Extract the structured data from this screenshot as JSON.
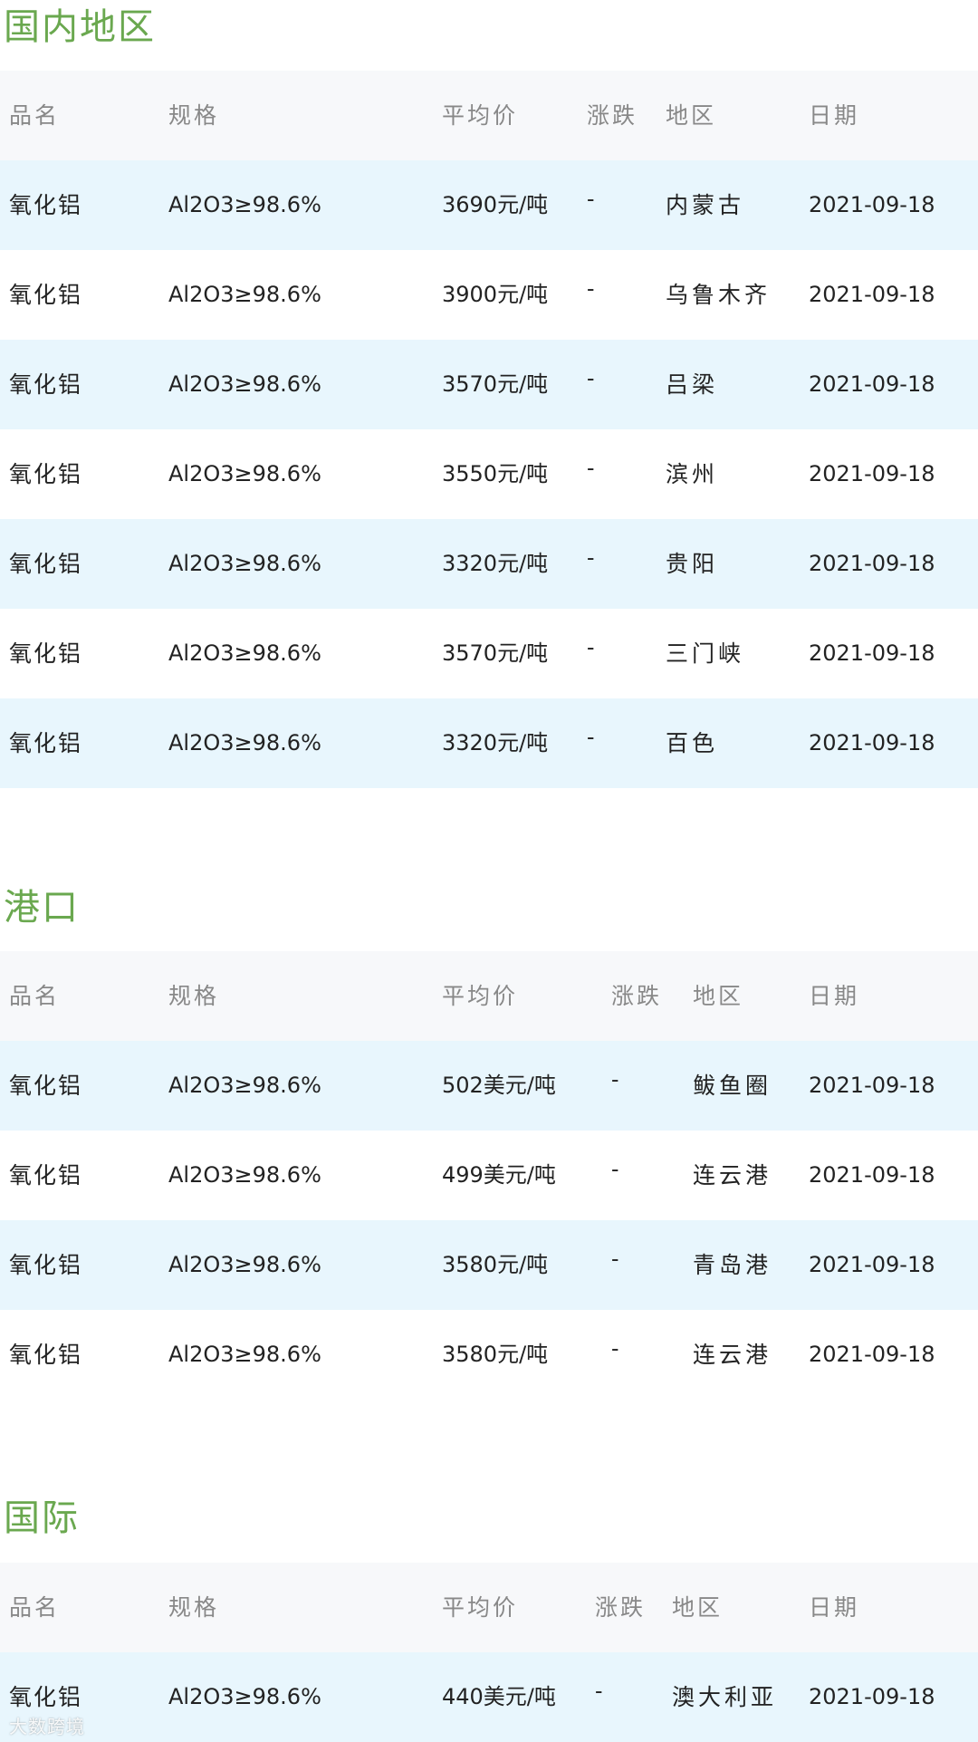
{
  "header": {
    "col_name": "品名",
    "col_spec": "规格",
    "col_price": "平均价",
    "col_change": "涨跌",
    "col_region": "地区",
    "col_date": "日期"
  },
  "domestic": {
    "title": "国内地区",
    "rows": [
      {
        "name": "氧化铝",
        "spec": "Al2O3≥98.6%",
        "price": "3690元/吨",
        "change": "-",
        "region": "内蒙古",
        "date": "2021-09-18"
      },
      {
        "name": "氧化铝",
        "spec": "Al2O3≥98.6%",
        "price": "3900元/吨",
        "change": "-",
        "region": "乌鲁木齐",
        "date": "2021-09-18"
      },
      {
        "name": "氧化铝",
        "spec": "Al2O3≥98.6%",
        "price": "3570元/吨",
        "change": "-",
        "region": "吕梁",
        "date": "2021-09-18"
      },
      {
        "name": "氧化铝",
        "spec": "Al2O3≥98.6%",
        "price": "3550元/吨",
        "change": "-",
        "region": "滨州",
        "date": "2021-09-18"
      },
      {
        "name": "氧化铝",
        "spec": "Al2O3≥98.6%",
        "price": "3320元/吨",
        "change": "-",
        "region": "贵阳",
        "date": "2021-09-18"
      },
      {
        "name": "氧化铝",
        "spec": "Al2O3≥98.6%",
        "price": "3570元/吨",
        "change": "-",
        "region": "三门峡",
        "date": "2021-09-18"
      },
      {
        "name": "氧化铝",
        "spec": "Al2O3≥98.6%",
        "price": "3320元/吨",
        "change": "-",
        "region": "百色",
        "date": "2021-09-18"
      }
    ]
  },
  "port": {
    "title": "港口",
    "rows": [
      {
        "name": "氧化铝",
        "spec": "Al2O3≥98.6%",
        "price": "502美元/吨",
        "change": "-",
        "region": "鲅鱼圈",
        "date": "2021-09-18"
      },
      {
        "name": "氧化铝",
        "spec": "Al2O3≥98.6%",
        "price": "499美元/吨",
        "change": "-",
        "region": "连云港",
        "date": "2021-09-18"
      },
      {
        "name": "氧化铝",
        "spec": "Al2O3≥98.6%",
        "price": "3580元/吨",
        "change": "-",
        "region": "青岛港",
        "date": "2021-09-18"
      },
      {
        "name": "氧化铝",
        "spec": "Al2O3≥98.6%",
        "price": "3580元/吨",
        "change": "-",
        "region": "连云港",
        "date": "2021-09-18"
      }
    ]
  },
  "international": {
    "title": "国际",
    "rows": [
      {
        "name": "氧化铝",
        "spec": "Al2O3≥98.6%",
        "price": "440美元/吨",
        "change": "-",
        "region": "澳大利亚",
        "date": "2021-09-18"
      }
    ]
  },
  "watermark": "大数跨境",
  "colors": {
    "title_green": "#6aa84f",
    "header_bg": "#f7f8fa",
    "stripe_bg": "#e8f6fd",
    "header_text": "#888888",
    "body_text": "#222222"
  }
}
